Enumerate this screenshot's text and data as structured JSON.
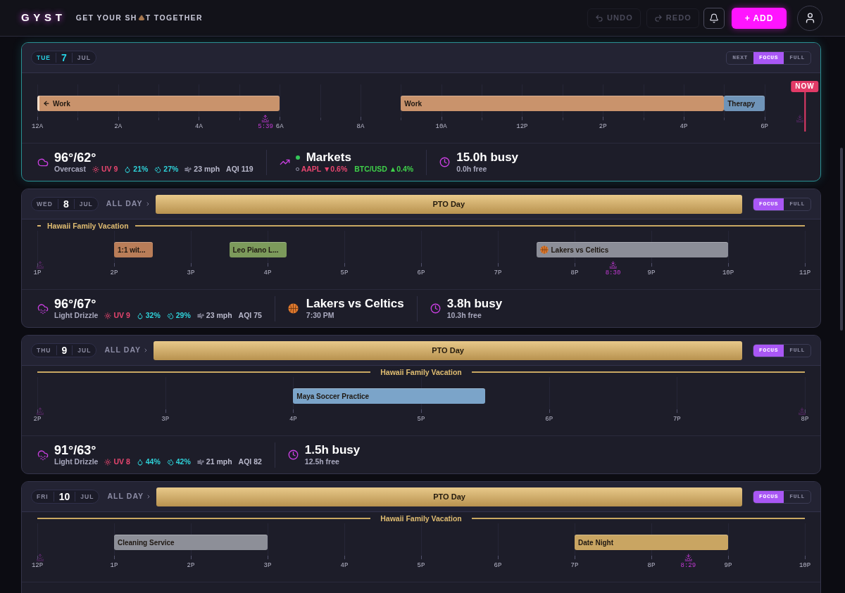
{
  "header": {
    "logo": "GYST",
    "tagline_start": "GET YOUR SH",
    "tagline_end": "T TOGETHER",
    "undo": {
      "label": "UNDO",
      "disabled": true
    },
    "redo": {
      "label": "REDO",
      "disabled": true
    },
    "add_label": "+ ADD"
  },
  "days": [
    {
      "today": true,
      "weekday": "TUE",
      "date": "7",
      "month": "JUL",
      "view_modes": [
        {
          "label": "NEXT",
          "selected": false
        },
        {
          "label": "FOCUS",
          "selected": true
        },
        {
          "label": "FULL",
          "selected": false
        }
      ],
      "timeline": {
        "ticks": [
          {
            "kind": "major",
            "label": "12A"
          },
          {
            "kind": "minor"
          },
          {
            "kind": "major",
            "label": "2A"
          },
          {
            "kind": "minor"
          },
          {
            "kind": "major",
            "label": "4A"
          },
          {
            "kind": "minor"
          },
          {
            "kind": "major",
            "label": "6A"
          },
          {
            "kind": "minor"
          },
          {
            "kind": "major",
            "label": "8A"
          },
          {
            "kind": "minor"
          },
          {
            "kind": "major",
            "label": "10A"
          },
          {
            "kind": "minor"
          },
          {
            "kind": "major",
            "label": "12P"
          },
          {
            "kind": "minor"
          },
          {
            "kind": "major",
            "label": "2P"
          },
          {
            "kind": "minor"
          },
          {
            "kind": "major",
            "label": "4P"
          },
          {
            "kind": "minor"
          },
          {
            "kind": "major",
            "label": "6P"
          },
          {
            "kind": "minor"
          }
        ],
        "events": [
          {
            "kind": "event",
            "title": "Work",
            "color": "#c9936c",
            "continued": true
          },
          {
            "kind": "event",
            "title": "Work",
            "color": "#c9936c",
            "continued": false
          },
          {
            "kind": "event",
            "title": "Therapy",
            "color": "#6f94b8",
            "continued": false
          }
        ],
        "markers": [
          {
            "kind": "sunrise",
            "label": "5:39",
            "dimmed": false
          },
          {
            "kind": "sunset",
            "dimmed": true
          },
          {
            "kind": "now",
            "label": "NOW"
          }
        ]
      },
      "sections": [
        {
          "kind": "weather",
          "temp": "96°/62°",
          "condition": {
            "kind": "cloudy",
            "text": "Overcast"
          },
          "uv": "UV 9",
          "precip": "21%",
          "humidity": "27%",
          "wind": "23 mph",
          "aqi": "AQI 119"
        },
        {
          "kind": "markets",
          "title": "Markets",
          "open": true,
          "tickers": [
            {
              "kind": "down",
              "text": "AAPL ▼0.6%",
              "market_closed": true
            },
            {
              "kind": "up",
              "text": "BTC/USD ▲0.4%",
              "market_closed": false
            }
          ]
        },
        {
          "kind": "busy",
          "busy": "15.0h busy",
          "free": "0.0h free"
        }
      ]
    },
    {
      "today": false,
      "weekday": "WED",
      "date": "8",
      "month": "JUL",
      "all_day": {
        "toggle_label": "ALL DAY",
        "title": "PTO Day"
      },
      "view_modes": [
        {
          "label": "FOCUS",
          "selected": true
        },
        {
          "label": "FULL",
          "selected": false
        }
      ],
      "banner": {
        "label": "Hawaii Family Vacation",
        "starts_today": true
      },
      "timeline": {
        "ticks": [
          {
            "kind": "major",
            "label": "1P"
          },
          {
            "kind": "major",
            "label": "2P"
          },
          {
            "kind": "major",
            "label": "3P"
          },
          {
            "kind": "major",
            "label": "4P"
          },
          {
            "kind": "major",
            "label": "5P"
          },
          {
            "kind": "major",
            "label": "6P"
          },
          {
            "kind": "major",
            "label": "7P"
          },
          {
            "kind": "major",
            "label": "8P"
          },
          {
            "kind": "major",
            "label": "9P"
          },
          {
            "kind": "major",
            "label": "10P"
          },
          {
            "kind": "major",
            "label": "11P"
          }
        ],
        "events": [
          {
            "kind": "event",
            "title": "1:1 wit...",
            "color": "#b97d58",
            "continued": false
          },
          {
            "kind": "event",
            "title": "Leo Piano L...",
            "color": "#7c9a5b",
            "continued": false
          },
          {
            "kind": "game",
            "title": "Lakers vs Celtics",
            "color": "#8c8e98",
            "continued": false
          }
        ],
        "markers": [
          {
            "kind": "sunrise",
            "dimmed": true
          },
          {
            "kind": "sunset",
            "label": "8:30",
            "dimmed": false
          }
        ]
      },
      "sections": [
        {
          "kind": "weather",
          "temp": "96°/67°",
          "condition": {
            "kind": "drizzle",
            "text": "Light Drizzle"
          },
          "uv": "UV 9",
          "precip": "32%",
          "humidity": "29%",
          "wind": "23 mph",
          "aqi": "AQI 75"
        },
        {
          "kind": "game",
          "title": "Lakers vs Celtics",
          "time": "7:30 PM"
        },
        {
          "kind": "busy",
          "busy": "3.8h busy",
          "free": "10.3h free"
        }
      ]
    },
    {
      "today": false,
      "weekday": "THU",
      "date": "9",
      "month": "JUL",
      "all_day": {
        "toggle_label": "ALL DAY",
        "title": "PTO Day"
      },
      "view_modes": [
        {
          "label": "FOCUS",
          "selected": true
        },
        {
          "label": "FULL",
          "selected": false
        }
      ],
      "banner": {
        "label": "Hawaii Family Vacation",
        "starts_today": false
      },
      "timeline": {
        "ticks": [
          {
            "kind": "major",
            "label": "2P"
          },
          {
            "kind": "major",
            "label": "3P"
          },
          {
            "kind": "major",
            "label": "4P"
          },
          {
            "kind": "major",
            "label": "5P"
          },
          {
            "kind": "major",
            "label": "6P"
          },
          {
            "kind": "major",
            "label": "7P"
          },
          {
            "kind": "major",
            "label": "8P"
          }
        ],
        "events": [
          {
            "kind": "event",
            "title": "Maya Soccer Practice",
            "color": "#7ba4c9",
            "continued": false
          }
        ],
        "markers": [
          {
            "kind": "sunrise",
            "dimmed": true
          },
          {
            "kind": "sunset",
            "dimmed": true
          }
        ]
      },
      "sections": [
        {
          "kind": "weather",
          "temp": "91°/63°",
          "condition": {
            "kind": "drizzle",
            "text": "Light Drizzle"
          },
          "uv": "UV 8",
          "precip": "44%",
          "humidity": "42%",
          "wind": "21 mph",
          "aqi": "AQI 82"
        },
        {
          "kind": "busy",
          "busy": "1.5h busy",
          "free": "12.5h free"
        }
      ]
    },
    {
      "today": false,
      "weekday": "FRI",
      "date": "10",
      "month": "JUL",
      "all_day": {
        "toggle_label": "ALL DAY",
        "title": "PTO Day"
      },
      "view_modes": [
        {
          "label": "FOCUS",
          "selected": true
        },
        {
          "label": "FULL",
          "selected": false
        }
      ],
      "banner": {
        "label": "Hawaii Family Vacation",
        "starts_today": false
      },
      "timeline": {
        "ticks": [
          {
            "kind": "major",
            "label": "12P"
          },
          {
            "kind": "major",
            "label": "1P"
          },
          {
            "kind": "major",
            "label": "2P"
          },
          {
            "kind": "major",
            "label": "3P"
          },
          {
            "kind": "major",
            "label": "4P"
          },
          {
            "kind": "major",
            "label": "5P"
          },
          {
            "kind": "major",
            "label": "6P"
          },
          {
            "kind": "major",
            "label": "7P"
          },
          {
            "kind": "major",
            "label": "8P"
          },
          {
            "kind": "major",
            "label": "9P"
          },
          {
            "kind": "major",
            "label": "10P"
          }
        ],
        "events": [
          {
            "kind": "event",
            "title": "Cleaning Service",
            "color": "#8d8f98",
            "continued": false
          },
          {
            "kind": "event",
            "title": "Date Night",
            "color": "#c9a562",
            "continued": false
          }
        ],
        "markers": [
          {
            "kind": "sunrise",
            "dimmed": true
          },
          {
            "kind": "sunset",
            "label": "8:29",
            "dimmed": false
          }
        ]
      }
    }
  ]
}
